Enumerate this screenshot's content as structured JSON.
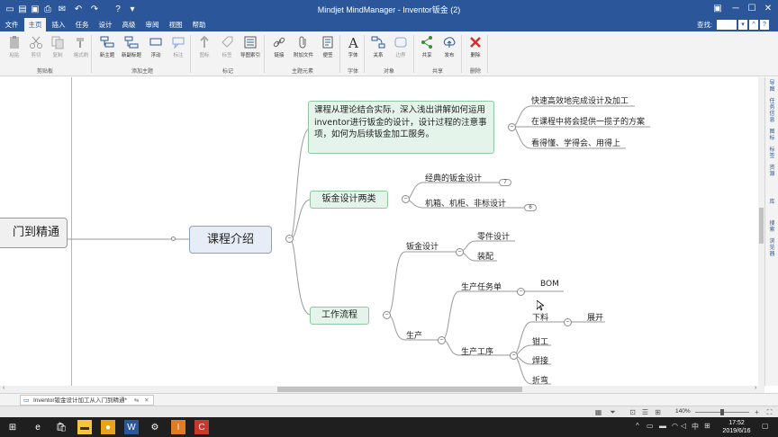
{
  "window": {
    "title": "Mindjet MindManager - Inventor钣金 (2)"
  },
  "menu": {
    "tabs": [
      "文件",
      "主页",
      "插入",
      "任务",
      "设计",
      "高级",
      "审阅",
      "视图",
      "帮助"
    ],
    "active": "主页",
    "search_label": "查找:"
  },
  "ribbon": {
    "buttons": [
      {
        "label": "粘贴",
        "icon": "paste-icon",
        "dim": true
      },
      {
        "label": "剪切",
        "icon": "scissors-icon",
        "dim": true
      },
      {
        "label": "复制",
        "icon": "copy-icon",
        "dim": true
      },
      {
        "label": "格式刷",
        "icon": "format-brush-icon",
        "dim": true
      },
      {
        "label": "新主题",
        "icon": "new-topic-icon",
        "dim": false
      },
      {
        "label": "新副标题",
        "icon": "new-subtopic-icon",
        "dim": false
      },
      {
        "label": "浮动",
        "icon": "floating-topic-icon",
        "dim": false
      },
      {
        "label": "标注",
        "icon": "callout-icon",
        "dim": true
      },
      {
        "label": "图标",
        "icon": "icon-marker-icon",
        "dim": true
      },
      {
        "label": "标签",
        "icon": "tag-icon",
        "dim": true
      },
      {
        "label": "导图索引",
        "icon": "map-index-icon",
        "dim": false
      },
      {
        "label": "链接",
        "icon": "link-icon",
        "dim": false
      },
      {
        "label": "附加文件",
        "icon": "attachment-icon",
        "dim": false
      },
      {
        "label": "便签",
        "icon": "note-icon",
        "dim": false
      },
      {
        "label": "字体",
        "icon": "font-icon",
        "dim": false
      },
      {
        "label": "关系",
        "icon": "relationship-icon",
        "dim": false
      },
      {
        "label": "边界",
        "icon": "boundary-icon",
        "dim": true
      },
      {
        "label": "共享",
        "icon": "share-icon",
        "dim": false
      },
      {
        "label": "发布",
        "icon": "publish-icon",
        "dim": false
      },
      {
        "label": "删除",
        "icon": "delete-icon",
        "dim": false
      }
    ],
    "groups": [
      "剪贴板",
      "添加主题",
      "标记",
      "主题元素",
      "字体",
      "对象",
      "共享",
      "删除"
    ]
  },
  "map": {
    "root_left": "门到精通",
    "central": "课程介绍",
    "intro": "课程从理论结合实际，深入浅出讲解如何运用inventor进行钣金的设计，设计过程的注意事项，如何为后续钣金加工服务。",
    "intro_children": [
      "快速高效地完成设计及加工",
      "在课程中将会提供一揽子的方案",
      "看得懂、学得会、用得上"
    ],
    "design_types": "钣金设计两类",
    "design_children": [
      {
        "label": "经典的钣金设计",
        "count": "7"
      },
      {
        "label": "机箱、机柜、非标设计",
        "count": "6"
      }
    ],
    "workflow": "工作流程",
    "sheet_design": "钣金设计",
    "sheet_children": [
      "零件设计",
      "装配"
    ],
    "production": "生产",
    "task_sheet": "生产任务单",
    "bom": "BOM",
    "process": "生产工序",
    "process_children": [
      "下料",
      "钳工",
      "焊接",
      "折弯"
    ],
    "unfold": "展开"
  },
  "side_panel": [
    "导图",
    "任务信息",
    "图标",
    "标签",
    "资源",
    "库",
    "搜索",
    "浏览器"
  ],
  "doc_tab": "Inventor钣金设计加工从入门到精通*",
  "status": {
    "zoom": "140%"
  },
  "taskbar": {
    "time": "17:52",
    "date": "2019/6/16",
    "lang": "中"
  }
}
